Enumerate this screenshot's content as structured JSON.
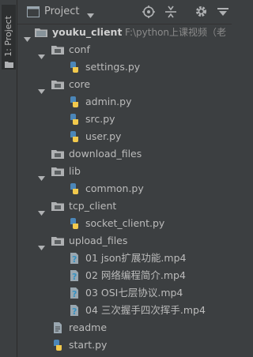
{
  "sidebar": {
    "tab_label": "1: Project"
  },
  "header": {
    "title": "Project"
  },
  "tree": {
    "root": {
      "name": "youku_client",
      "path": "F:\\python上课视频（老"
    },
    "conf": {
      "name": "conf",
      "files": [
        "settings.py"
      ]
    },
    "core": {
      "name": "core",
      "files": [
        "admin.py",
        "src.py",
        "user.py"
      ]
    },
    "download_files": {
      "name": "download_files"
    },
    "lib": {
      "name": "lib",
      "files": [
        "common.py"
      ]
    },
    "tcp_client": {
      "name": "tcp_client",
      "files": [
        "socket_client.py"
      ]
    },
    "upload_files": {
      "name": "upload_files",
      "files": [
        "01 json扩展功能.mp4",
        "02 网络编程简介.mp4",
        "03 OSI七层协议.mp4",
        "04 三次握手四次挥手.mp4"
      ]
    },
    "readme": "readme",
    "start": "start.py"
  }
}
